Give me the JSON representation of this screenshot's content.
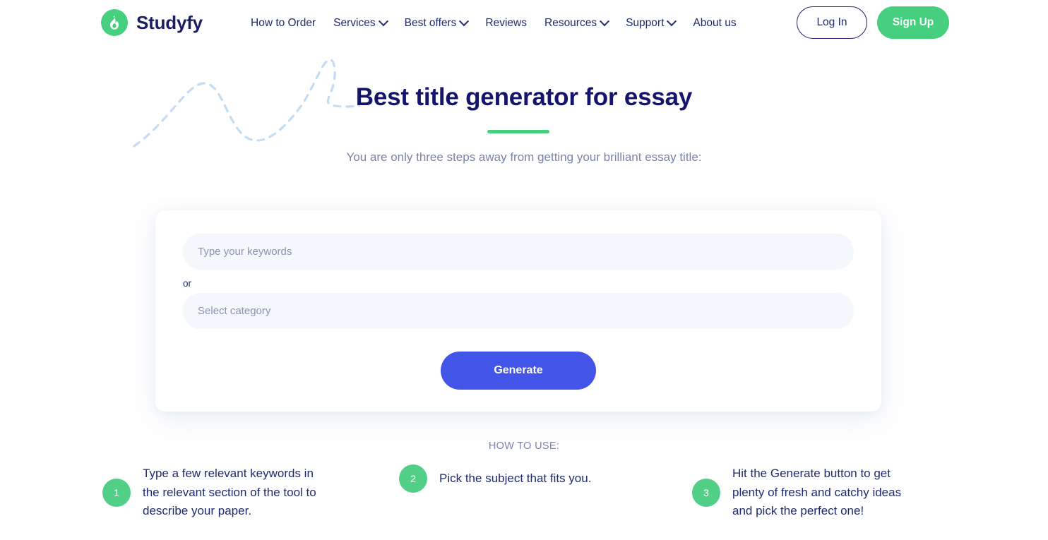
{
  "header": {
    "brand": {
      "name": "Studyfy",
      "icon": "flame-icon",
      "mark_color": "#45cf7f"
    },
    "nav": [
      {
        "label": "How to Order",
        "has_dropdown": false
      },
      {
        "label": "Services",
        "has_dropdown": true
      },
      {
        "label": "Best offers",
        "has_dropdown": true
      },
      {
        "label": "Reviews",
        "has_dropdown": false
      },
      {
        "label": "Resources",
        "has_dropdown": true
      },
      {
        "label": "Support",
        "has_dropdown": true
      },
      {
        "label": "About us",
        "has_dropdown": false
      }
    ],
    "login_label": "Log In",
    "signup_label": "Sign Up"
  },
  "hero": {
    "title": "Best title generator for essay",
    "subtitle": "You are only three steps away from getting your brilliant essay title:",
    "accent_color": "#45cf7f"
  },
  "form": {
    "keywords_placeholder": "Type your keywords",
    "keywords_value": "",
    "or_label": "or",
    "category_placeholder": "Select category",
    "category_value": "",
    "generate_label": "Generate",
    "generate_color": "#4355e8"
  },
  "howto": {
    "label": "HOW TO USE:",
    "steps": [
      {
        "number": "1",
        "text": "Type a few relevant keywords in the relevant section of the tool to describe your paper."
      },
      {
        "number": "2",
        "text": "Pick the subject that fits you."
      },
      {
        "number": "3",
        "text": "Hit the Generate button to get plenty of fresh and catchy ideas and pick the perfect one!"
      }
    ]
  }
}
